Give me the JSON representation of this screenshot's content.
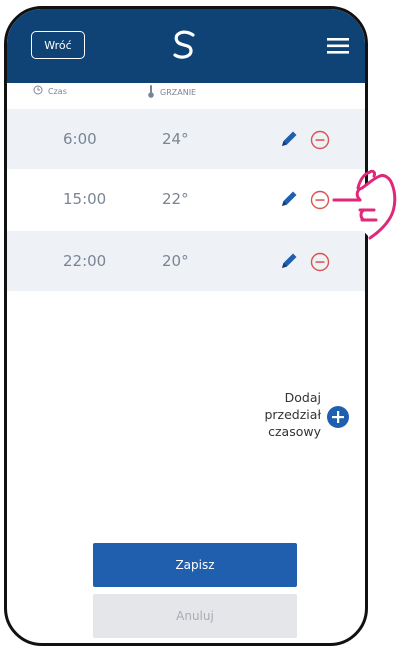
{
  "header": {
    "back_label": "Wróć"
  },
  "columns": {
    "time_label": "Czas",
    "temp_label": "GRZANIE"
  },
  "schedule": [
    {
      "time": "6:00",
      "temp": "24°"
    },
    {
      "time": "15:00",
      "temp": "22°"
    },
    {
      "time": "22:00",
      "temp": "20°"
    }
  ],
  "add_interval": {
    "line1": "Dodaj",
    "line2": "przedział",
    "line3": "czasowy"
  },
  "actions": {
    "save_label": "Zapisz",
    "cancel_label": "Anuluj"
  },
  "colors": {
    "header": "#0f4275",
    "primary": "#1f5fae",
    "delete": "#d9534f",
    "row_shade": "#eef2f7",
    "hand": "#e0287a"
  },
  "icons": [
    "logo-icon",
    "menu-icon",
    "clock-icon",
    "thermometer-icon",
    "pencil-icon",
    "minus-circle-icon",
    "plus-circle-icon",
    "pointing-hand-icon"
  ]
}
